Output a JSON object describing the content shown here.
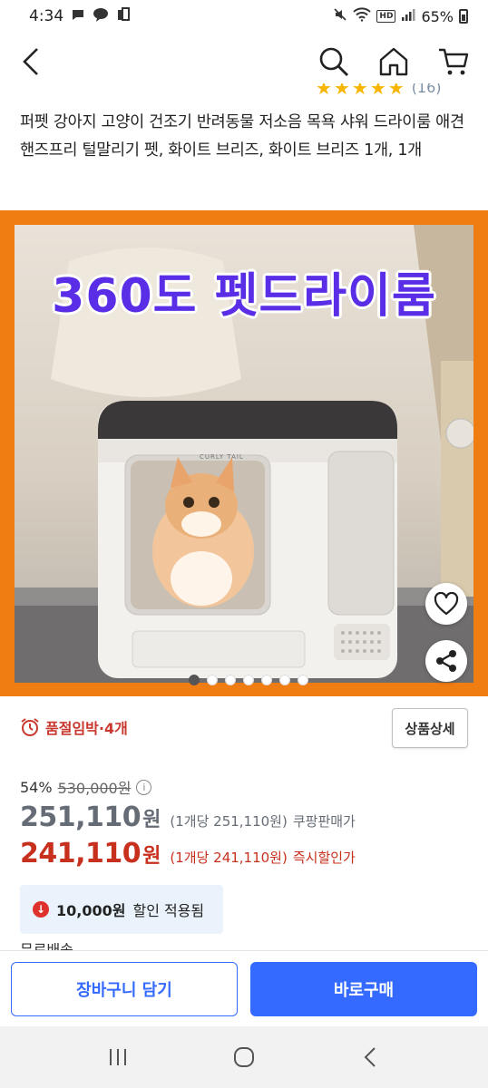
{
  "status_bar": {
    "time": "4:34",
    "battery": "65%",
    "left_icons": [
      "chat-icon",
      "talk-icon",
      "tasks-icon"
    ],
    "right_icons": [
      "mute-icon",
      "wifi-icon",
      "hd-voice-icon",
      "signal-icon",
      "battery-icon"
    ],
    "hd_label": "HD"
  },
  "app_bar": {
    "icons": [
      "back-icon",
      "search-icon",
      "home-icon",
      "cart-icon"
    ]
  },
  "rating": {
    "stars": 5,
    "count_text": "(16)"
  },
  "product": {
    "title": "퍼펫 강아지 고양이 건조기 반려동물 저소음 목욕 샤워 드라이룸 애견 핸즈프리 털말리기 펫, 화이트 브리즈, 화이트 브리즈 1개, 1개",
    "image_headline": "360도 펫드라이룸",
    "image_brand": "CURLY TAIL",
    "carousel_count": 7,
    "carousel_active_index": 0
  },
  "stock": {
    "icon": "alarm-clock-icon",
    "text": "품절임박·4개"
  },
  "detail_button": "상품상세",
  "pricing": {
    "discount_rate": "54%",
    "original_price": "530,000원",
    "coupang_price": "251,110",
    "coupang_won": "원",
    "coupang_unit": "(1개당 251,110원)",
    "coupang_label": "쿠팡판매가",
    "instant_price": "241,110",
    "instant_won": "원",
    "instant_unit": "(1개당 241,110원)",
    "instant_label": "즉시할인가"
  },
  "coupon": {
    "amount": "10,000원",
    "text": "할인 적용됨"
  },
  "peek_text": "무료배송",
  "buttons": {
    "cart": "장바구니 담기",
    "buy": "바로구매"
  },
  "colors": {
    "accent_blue": "#346aff",
    "discount_red": "#c8301e",
    "image_frame_orange": "#f07d12",
    "star_yellow": "#f7b500"
  }
}
